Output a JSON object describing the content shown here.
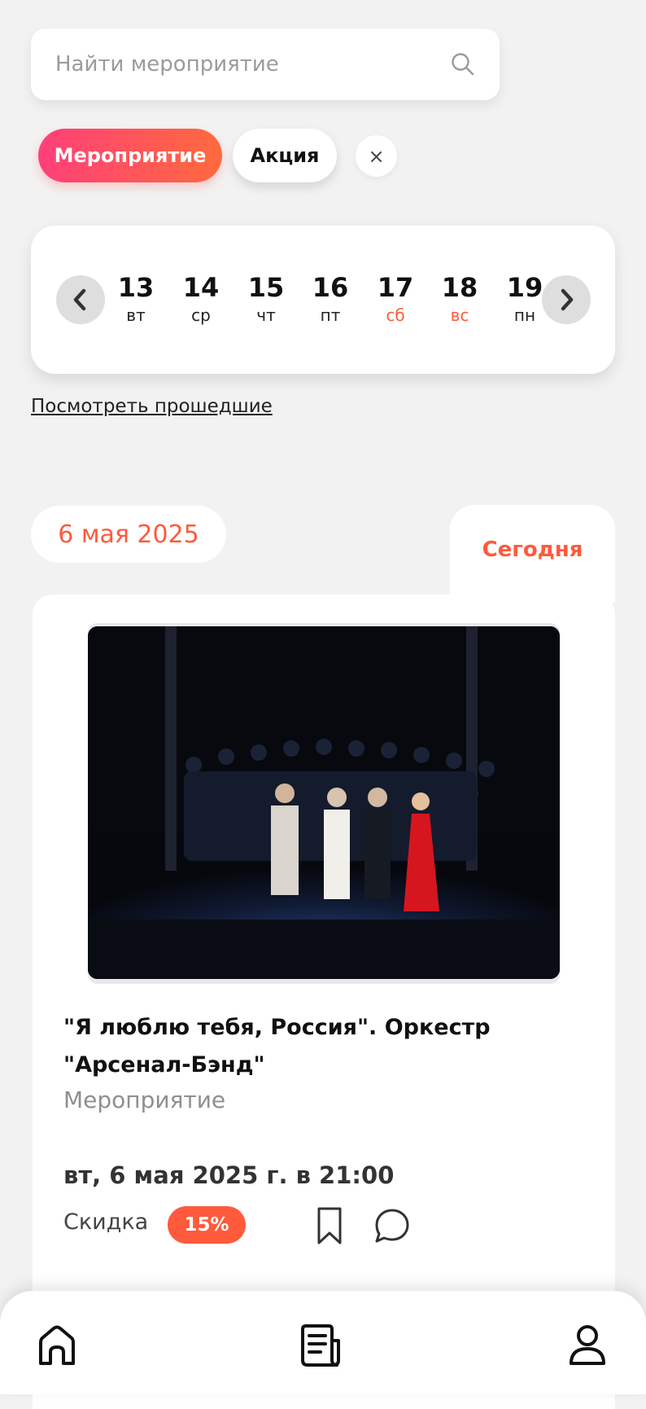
{
  "search": {
    "placeholder": "Найти мероприятие",
    "icon": "search-icon"
  },
  "filters": {
    "event_label": "Мероприятие",
    "promo_label": "Акция",
    "clear_label": "×"
  },
  "calendar": {
    "days": [
      {
        "num": "13",
        "dow": "вт",
        "weekend": false
      },
      {
        "num": "14",
        "dow": "ср",
        "weekend": false
      },
      {
        "num": "15",
        "dow": "чт",
        "weekend": false
      },
      {
        "num": "16",
        "dow": "пт",
        "weekend": false
      },
      {
        "num": "17",
        "dow": "сб",
        "weekend": true
      },
      {
        "num": "18",
        "dow": "вс",
        "weekend": true
      },
      {
        "num": "19",
        "dow": "пн",
        "weekend": false
      }
    ]
  },
  "past_link": "Посмотреть прошедшие",
  "date_label": "6 мая 2025",
  "today_label": "Сегодня",
  "event": {
    "title": "\"Я люблю тебя, Россия\". Оркестр \"Арсенал-Бэнд\"",
    "category": "Мероприятие",
    "datetime": "вт, 6 мая 2025 г. в 21:00",
    "discount_label": "Скидка",
    "discount_value": "15%"
  },
  "colors": {
    "accent": "#ff5a3c",
    "gradient_start": "#ff3f7a",
    "gradient_end": "#ff6a3d",
    "background": "#f2f2f2"
  },
  "nav": {
    "icons": [
      "home-icon",
      "news-icon",
      "profile-icon"
    ]
  }
}
